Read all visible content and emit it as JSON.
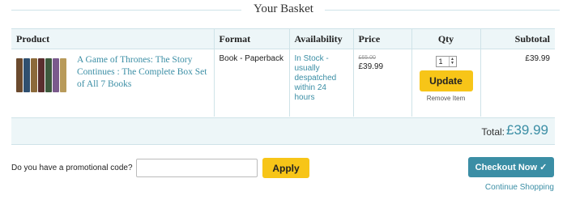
{
  "header": {
    "title": "Your Basket"
  },
  "table": {
    "columns": [
      "Product",
      "Format",
      "Availability",
      "Price",
      "Qty",
      "Subtotal"
    ],
    "rows": [
      {
        "title": "A Game of Thrones: The Story Continues : The Complete Box Set of All 7 Books",
        "format": "Book - Paperback",
        "availability": "In Stock - usually despatched within 24 hours",
        "price_old": "£65.00",
        "price": "£39.99",
        "qty": "1",
        "update_label": "Update",
        "remove_label": "Remove Item",
        "subtotal": "£39.99"
      }
    ]
  },
  "total": {
    "label": "Total:",
    "value": "£39.99"
  },
  "promo": {
    "label": "Do you have a promotional code?",
    "input_value": "",
    "apply_label": "Apply"
  },
  "checkout": {
    "label": "Checkout Now ✓",
    "continue_label": "Continue Shopping"
  },
  "colors": {
    "accent": "#3b8ea5",
    "button_yellow": "#f7c518",
    "table_bg": "#edf6f8"
  },
  "icons": {
    "book_image": "book-box-set-image",
    "qty_spinner": "spinner-arrows-icon"
  }
}
